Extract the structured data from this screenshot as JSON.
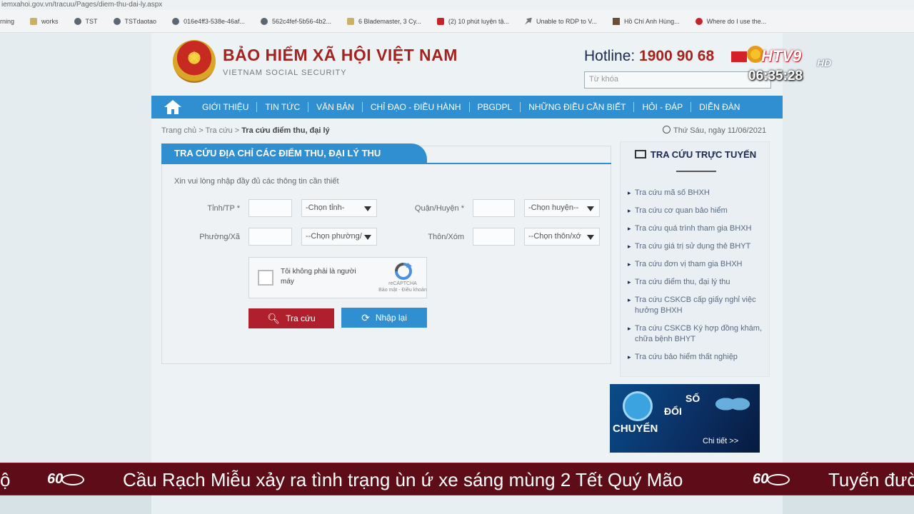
{
  "browser": {
    "url": "iemxahoi.gov.vn/tracuu/Pages/diem-thu-dai-ly.aspx",
    "bookmarks": [
      {
        "label": "rning",
        "icon": "none"
      },
      {
        "label": "works",
        "icon": "folder-icon"
      },
      {
        "label": "TST",
        "icon": "globe-icon"
      },
      {
        "label": "TSTdaotao",
        "icon": "globe-icon"
      },
      {
        "label": "016e4ff3-538e-46af...",
        "icon": "globe-icon"
      },
      {
        "label": "562c4fef-5b56-4b2...",
        "icon": "globe-icon"
      },
      {
        "label": "6 Blademaster, 3 Cy...",
        "icon": "page-icon"
      },
      {
        "label": "(2) 10 phút luyện tậ...",
        "icon": "youtube-icon"
      },
      {
        "label": "Unable to RDP to V...",
        "icon": "arrow-icon"
      },
      {
        "label": "Hồ Chí Anh Hùng...",
        "icon": "image-icon"
      },
      {
        "label": "Where do I use the...",
        "icon": "red-circle-icon"
      }
    ]
  },
  "header": {
    "title": "BẢO HIỂM XÃ HỘI VIỆT NAM",
    "subtitle": "VIETNAM SOCIAL SECURITY",
    "hotline_label": "Hotline:",
    "hotline_number": "1900 90 68",
    "search_placeholder": "Từ khóa"
  },
  "nav": {
    "items": [
      "GIỚI THIỆU",
      "TIN TỨC",
      "VĂN BẢN",
      "CHỈ ĐẠO - ĐIỀU HÀNH",
      "PBGDPL",
      "NHỮNG ĐIỀU CẦN BIẾT",
      "HỎI - ĐÁP",
      "DIỄN ĐÀN"
    ]
  },
  "breadcrumb": {
    "home": "Trang chủ",
    "sep": ">",
    "section": "Tra cứu",
    "current": "Tra cứu điểm thu, đại lý"
  },
  "date": "Thứ Sáu, ngày 11/06/2021",
  "form": {
    "title": "TRA CỨU ĐỊA CHỈ CÁC ĐIỂM THU, ĐẠI LÝ THU",
    "instruction": "Xin vui lòng nhập đầy đủ các thông tin cần thiết",
    "province_label": "Tỉnh/TP *",
    "province_select": "-Chọn tỉnh-",
    "district_label": "Quận/Huyện *",
    "district_select": "-Chọn huyện--",
    "ward_label": "Phường/Xã",
    "ward_select": "--Chọn phường/",
    "village_label": "Thôn/Xóm",
    "village_select": "--Chọn thôn/xớ",
    "captcha_text": "Tôi không phải là người máy",
    "captcha_brand": "reCAPTCHA",
    "captcha_terms": "Bảo mật - Điều khoản",
    "search_button": "Tra cứu",
    "reset_button": "Nhập lại"
  },
  "sidebar": {
    "title": "TRA CỨU TRỰC TUYẾN",
    "items": [
      "Tra cứu mã số BHXH",
      "Tra cứu cơ quan bảo hiểm",
      "Tra cứu quá trình tham gia BHXH",
      "Tra cứu giá trị sử dụng thẻ BHYT",
      "Tra cứu đơn vị tham gia BHXH",
      "Tra cứu điểm thu, đại lý thu",
      "Tra cứu CSKCB cấp giấy nghỉ việc hưởng BHXH",
      "Tra cứu CSKCB Ký hợp đồng khám, chữa bệnh BHYT",
      "Tra cứu bảo hiểm thất nghiệp"
    ]
  },
  "banner": {
    "word1": "SỐ",
    "word2": "ĐỔI",
    "word3": "CHUYỂN",
    "link": "Chi tiết >>"
  },
  "broadcast": {
    "channel": "HTV9",
    "hd": "HD",
    "time": "06:35:28",
    "ticker_left_fragment": "ộ",
    "ticker_headline": "Cầu Rạch Miễu xảy ra tình trạng ùn ứ xe sáng mùng 2 Tết Quý Mão",
    "ticker_next": "Tuyến đườ",
    "ticker_logo": "60"
  },
  "colors": {
    "nav_blue": "#2f8fd1",
    "brand_red": "#a5221f",
    "ticker_bg": "#5e0d18"
  }
}
